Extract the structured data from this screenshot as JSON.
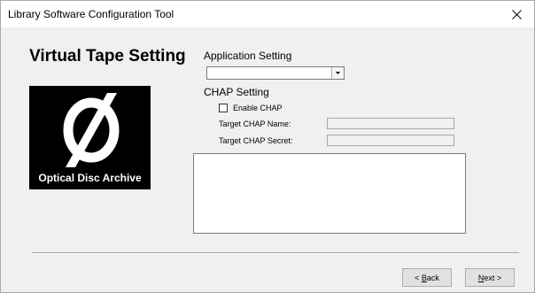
{
  "window": {
    "title": "Library Software Configuration Tool",
    "close_glyph": "✕"
  },
  "panel": {
    "heading": "Virtual Tape Setting",
    "logo_caption": "Optical Disc Archive"
  },
  "application_setting": {
    "label": "Application Setting",
    "selected_value": ""
  },
  "chap": {
    "label": "CHAP Setting",
    "enable_label": "Enable CHAP",
    "enable_checked": false,
    "name_label": "Target CHAP Name:",
    "name_value": "",
    "secret_label": "Target CHAP Secret:",
    "secret_value": ""
  },
  "log": {
    "text": ""
  },
  "footer": {
    "back_prefix": "< ",
    "back_mnemonic": "B",
    "back_rest": "ack",
    "next_mnemonic": "N",
    "next_rest": "ext >"
  },
  "icons": {
    "close": "close-icon",
    "dropdown": "chevron-down-icon",
    "logo": "disc-logo-icon"
  }
}
